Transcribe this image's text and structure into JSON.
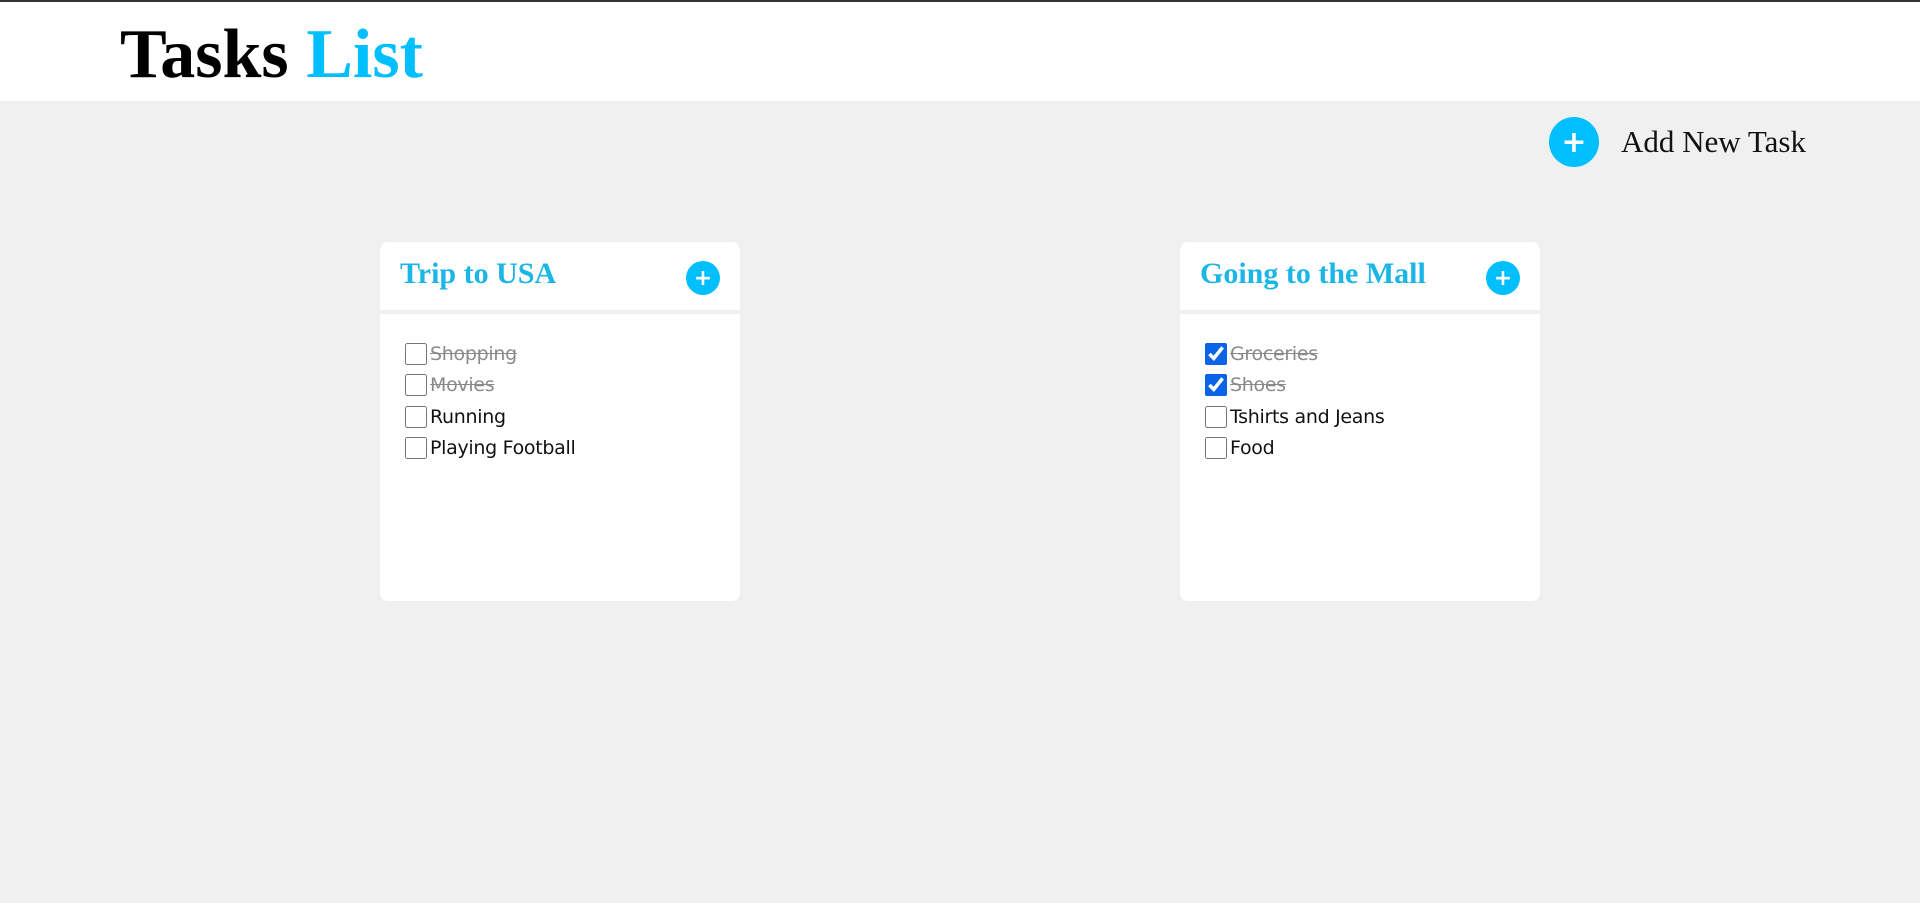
{
  "header": {
    "title_part1": "Tasks",
    "title_part2": "List"
  },
  "actions": {
    "add_new_task_label": "Add New Task",
    "plus_icon": "+"
  },
  "colors": {
    "accent": "#00bfff",
    "title_blue": "#1ab6e6",
    "background": "#f0f0f0",
    "card": "#ffffff",
    "checkbox_checked": "#0b63e6"
  },
  "lists": [
    {
      "title": "Trip to USA",
      "tasks": [
        {
          "label": "Shopping",
          "checked": false,
          "done": true
        },
        {
          "label": "Movies",
          "checked": false,
          "done": true
        },
        {
          "label": "Running",
          "checked": false,
          "done": false
        },
        {
          "label": "Playing Football",
          "checked": false,
          "done": false
        }
      ]
    },
    {
      "title": "Going to the Mall",
      "tasks": [
        {
          "label": "Groceries",
          "checked": true,
          "done": true
        },
        {
          "label": "Shoes",
          "checked": true,
          "done": true
        },
        {
          "label": "Tshirts and Jeans",
          "checked": false,
          "done": false
        },
        {
          "label": "Food",
          "checked": false,
          "done": false
        }
      ]
    }
  ]
}
